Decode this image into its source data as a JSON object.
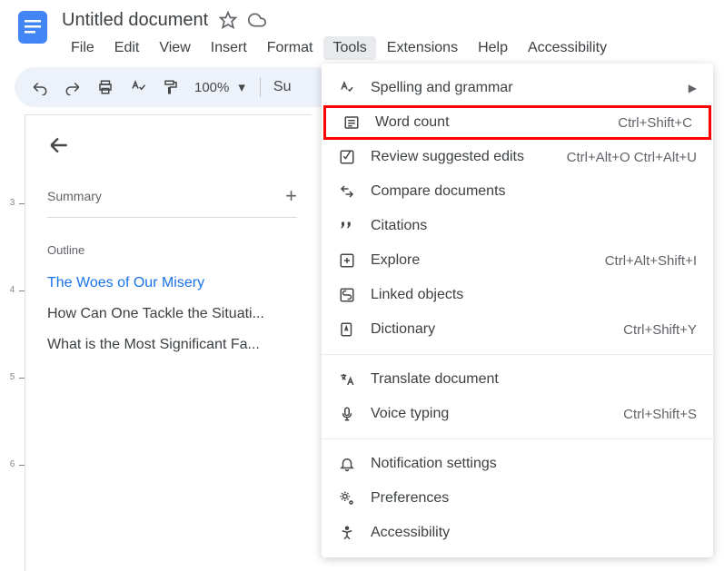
{
  "header": {
    "title": "Untitled document"
  },
  "menubar": {
    "items": [
      "File",
      "Edit",
      "View",
      "Insert",
      "Format",
      "Tools",
      "Extensions",
      "Help",
      "Accessibility"
    ],
    "active_index": 5
  },
  "toolbar": {
    "zoom": "100%",
    "style": "Su"
  },
  "sidebar": {
    "summary_label": "Summary",
    "outline_label": "Outline",
    "outline_items": [
      {
        "label": "The Woes of Our Misery",
        "selected": true
      },
      {
        "label": "How Can One Tackle the Situati...",
        "selected": false
      },
      {
        "label": "What is the Most Significant Fa...",
        "selected": false
      }
    ]
  },
  "ruler": {
    "marks": [
      "3",
      "4",
      "5",
      "6"
    ]
  },
  "dropdown": {
    "groups": [
      [
        {
          "icon": "spell",
          "label": "Spelling and grammar",
          "shortcut": "",
          "submenu": true
        },
        {
          "icon": "wordcount",
          "label": "Word count",
          "shortcut": "Ctrl+Shift+C",
          "highlighted": true
        },
        {
          "icon": "review",
          "label": "Review suggested edits",
          "shortcut": "Ctrl+Alt+O Ctrl+Alt+U"
        },
        {
          "icon": "compare",
          "label": "Compare documents",
          "shortcut": ""
        },
        {
          "icon": "citations",
          "label": "Citations",
          "shortcut": ""
        },
        {
          "icon": "explore",
          "label": "Explore",
          "shortcut": "Ctrl+Alt+Shift+I"
        },
        {
          "icon": "linked",
          "label": "Linked objects",
          "shortcut": ""
        },
        {
          "icon": "dictionary",
          "label": "Dictionary",
          "shortcut": "Ctrl+Shift+Y"
        }
      ],
      [
        {
          "icon": "translate",
          "label": "Translate document",
          "shortcut": ""
        },
        {
          "icon": "voice",
          "label": "Voice typing",
          "shortcut": "Ctrl+Shift+S"
        }
      ],
      [
        {
          "icon": "bell",
          "label": "Notification settings",
          "shortcut": ""
        },
        {
          "icon": "prefs",
          "label": "Preferences",
          "shortcut": ""
        },
        {
          "icon": "access",
          "label": "Accessibility",
          "shortcut": ""
        }
      ]
    ]
  }
}
